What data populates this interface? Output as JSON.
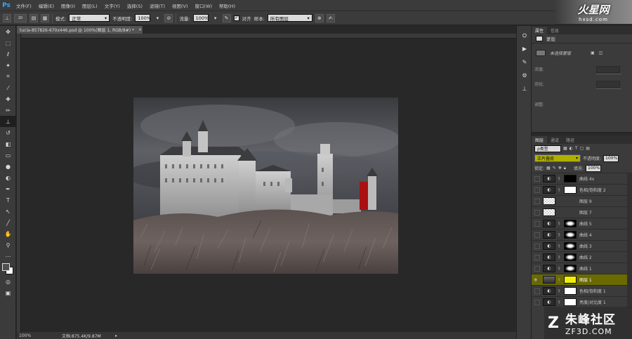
{
  "app": {
    "logo_text": "Ps"
  },
  "menu": [
    "文件(F)",
    "编辑(E)",
    "图像(I)",
    "图层(L)",
    "文字(Y)",
    "选择(S)",
    "滤镜(T)",
    "视图(V)",
    "窗口(W)",
    "帮助(H)"
  ],
  "site_logo": {
    "main": "火星网",
    "sub": "hxsd.com"
  },
  "options": {
    "brush_size": "20",
    "mode_label": "模式:",
    "mode_value": "正常",
    "opacity_label": "不透明度:",
    "opacity_value": "100%",
    "flow_label": "流量:",
    "flow_value": "100%",
    "aligned_label": "对齐",
    "sample_label": "样本:",
    "sample_value": "所有图层"
  },
  "document": {
    "tab_title": "tucia-857826-670x446.psd @ 100%(图层 1, RGB/8#) *",
    "zoom": "100%",
    "doc_info": "文档:875.4K/9.87M"
  },
  "properties": {
    "tabs": [
      "属性",
      "信息"
    ],
    "header": "蒙版",
    "mask_label": "未选择蒙版",
    "density_label": "浓度:",
    "feather_label": "羽化:",
    "adjust_label": "调整:"
  },
  "layers_panel": {
    "tabs": [
      "图层",
      "通道",
      "路径"
    ],
    "kind_label": "ρ类型",
    "blend_mode": "正片叠底",
    "opacity_label": "不透明度:",
    "opacity_value": "100%",
    "lock_label": "锁定:",
    "fill_label": "填充:",
    "fill_value": "100%",
    "layers": [
      {
        "name": "曲线 4x",
        "thumb": "adj",
        "mask": "black",
        "selected": false
      },
      {
        "name": "色相/饱和度 2",
        "thumb": "adj",
        "mask": "white",
        "selected": false
      },
      {
        "name": "图层 9",
        "thumb": "checker",
        "mask": "",
        "selected": false
      },
      {
        "name": "图层 7",
        "thumb": "checker",
        "mask": "",
        "selected": false
      },
      {
        "name": "曲线 5",
        "thumb": "adj",
        "mask": "curve",
        "selected": false
      },
      {
        "name": "曲线 4",
        "thumb": "adj",
        "mask": "curve",
        "selected": false
      },
      {
        "name": "曲线 3",
        "thumb": "adj",
        "mask": "curve",
        "selected": false
      },
      {
        "name": "曲线 2",
        "thumb": "adj",
        "mask": "curve",
        "selected": false
      },
      {
        "name": "曲线 1",
        "thumb": "adj",
        "mask": "curve",
        "selected": false
      },
      {
        "name": "图层 1",
        "thumb": "photo",
        "mask": "yellow",
        "selected": true
      },
      {
        "name": "色相/饱和度 1",
        "thumb": "adj",
        "mask": "white",
        "selected": false
      },
      {
        "name": "亮度/对比度 1",
        "thumb": "adj",
        "mask": "white",
        "selected": false
      }
    ]
  },
  "watermark": {
    "main": "朱峰社区",
    "sub": "ZF3D.COM"
  }
}
